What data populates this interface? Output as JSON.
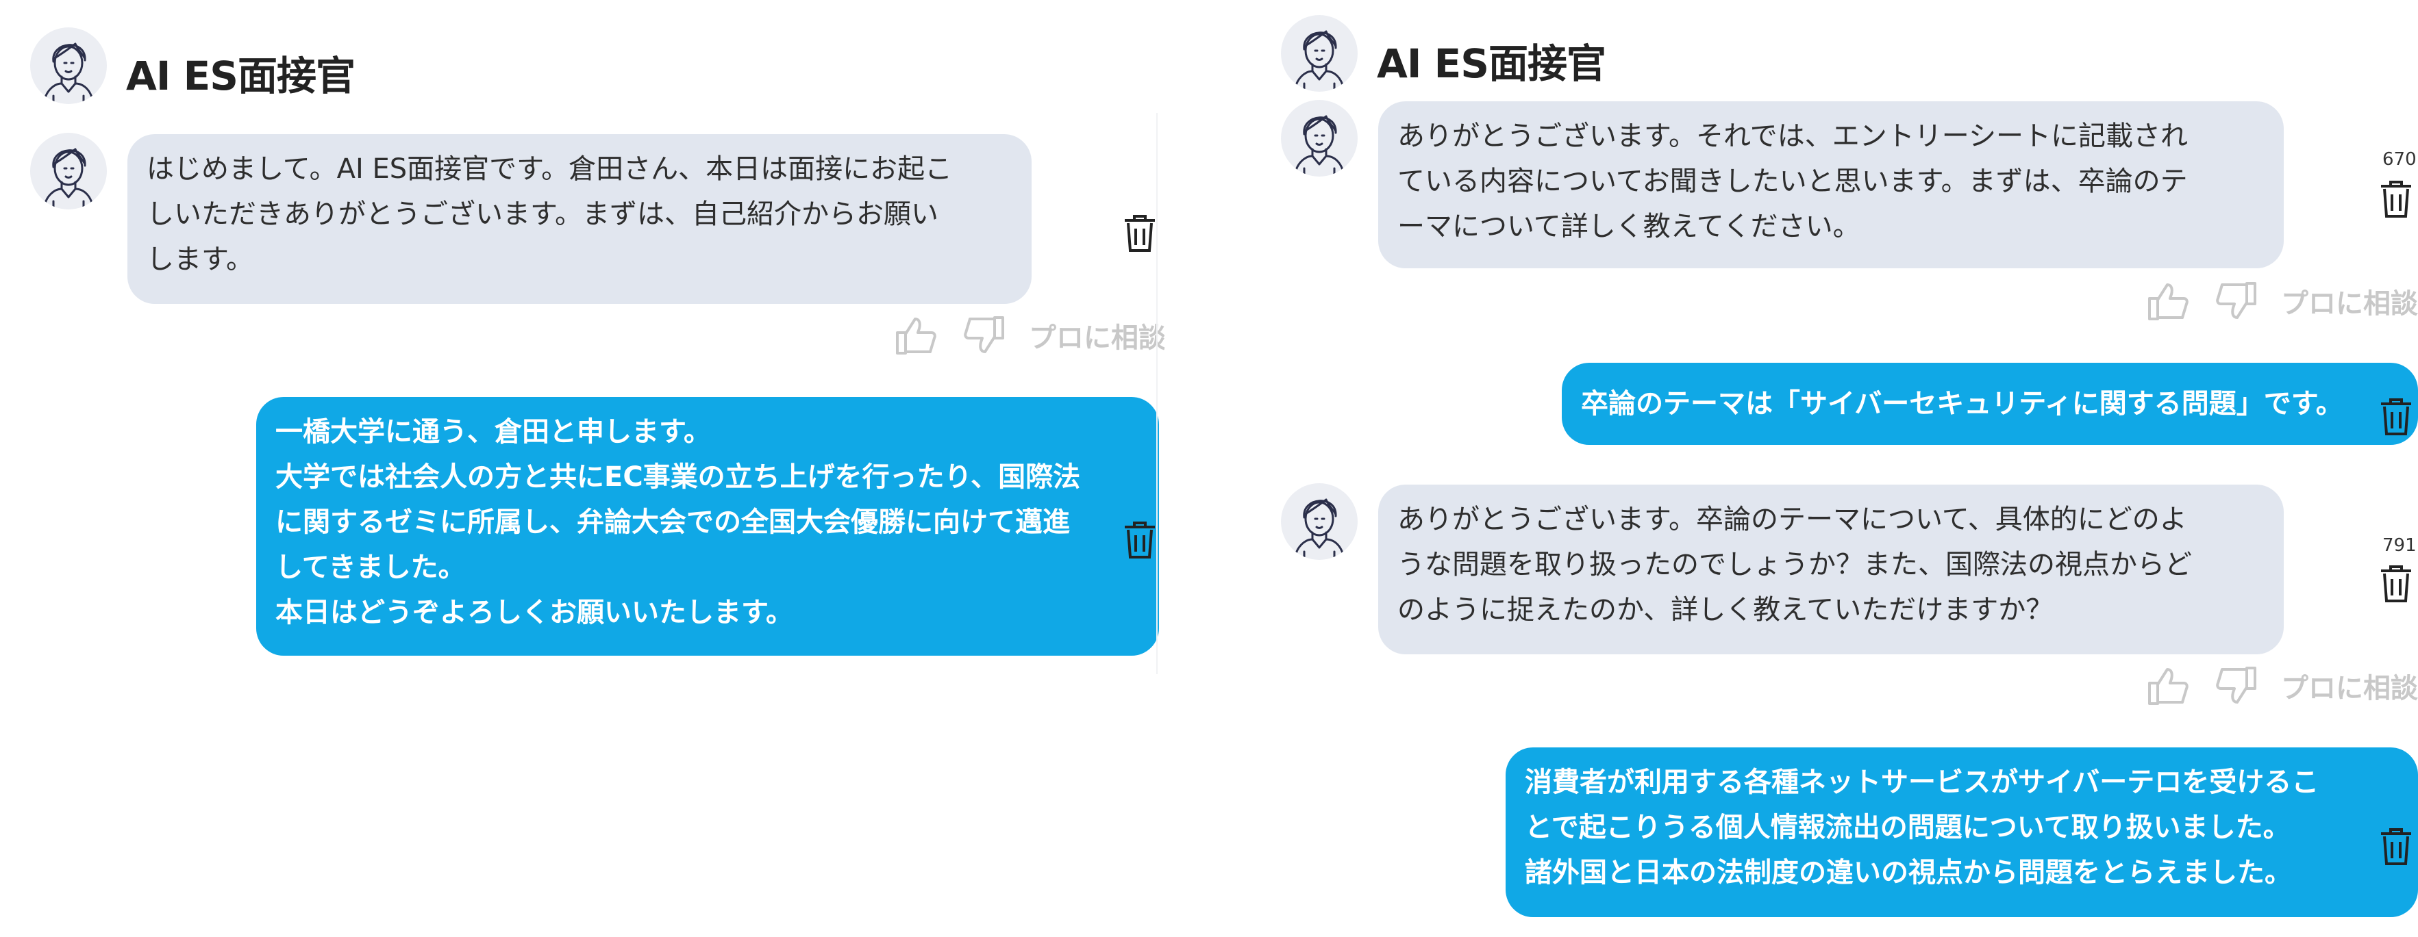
{
  "left_panel": {
    "header": {
      "title": "AI ES面接官"
    },
    "messages": [
      {
        "role": "ai",
        "text": "はじめまして。AI ES面接官です。倉田さん、本日は面接にお起こ\nしいただきありがとうございます。まずは、自己紹介からお願い\nします。"
      },
      {
        "role": "user",
        "text": "一橋大学に通う、倉田と申します。\n大学では社会人の方と共にEC事業の立ち上げを行ったり、国際法\nに関するゼミに所属し、弁論大会での全国大会優勝に向けて邁進\nしてきました。\n本日はどうぞよろしくお願いいたします。"
      }
    ],
    "feedback": {
      "consult_label": "プロに相談"
    }
  },
  "right_panel": {
    "header": {
      "title": "AI ES面接官"
    },
    "messages": [
      {
        "role": "ai",
        "text": "ありがとうございます。それでは、エントリーシートに記載され\nている内容についてお聞きしたいと思います。まずは、卒論のテ\nーマについて詳しく教えてください。",
        "token_count": "670"
      },
      {
        "role": "user",
        "text": "卒論のテーマは「サイバーセキュリティに関する問題」です。"
      },
      {
        "role": "ai",
        "text": "ありがとうございます。卒論のテーマについて、具体的にどのよ\nうな問題を取り扱ったのでしょうか？また、国際法の視点からど\nのように捉えたのか、詳しく教えていただけますか？",
        "token_count": "791"
      },
      {
        "role": "user",
        "text": "消費者が利用する各種ネットサービスがサイバーテロを受けるこ\nとで起こりうる個人情報流出の問題について取り扱いました。\n諸外国と日本の法制度の違いの視点から問題をとらえました。"
      }
    ],
    "feedback": {
      "consult_label": "プロに相談"
    }
  },
  "icons": {
    "avatar": "interviewer-avatar-icon",
    "delete": "trash-icon",
    "like": "thumbs-up-icon",
    "dislike": "thumbs-down-icon"
  },
  "colors": {
    "ai_bubble": "#e1e6ef",
    "user_bubble": "#10a8e6",
    "user_text": "#ffffff",
    "muted": "#c8c8c8",
    "avatar_bg": "#eceef3"
  }
}
